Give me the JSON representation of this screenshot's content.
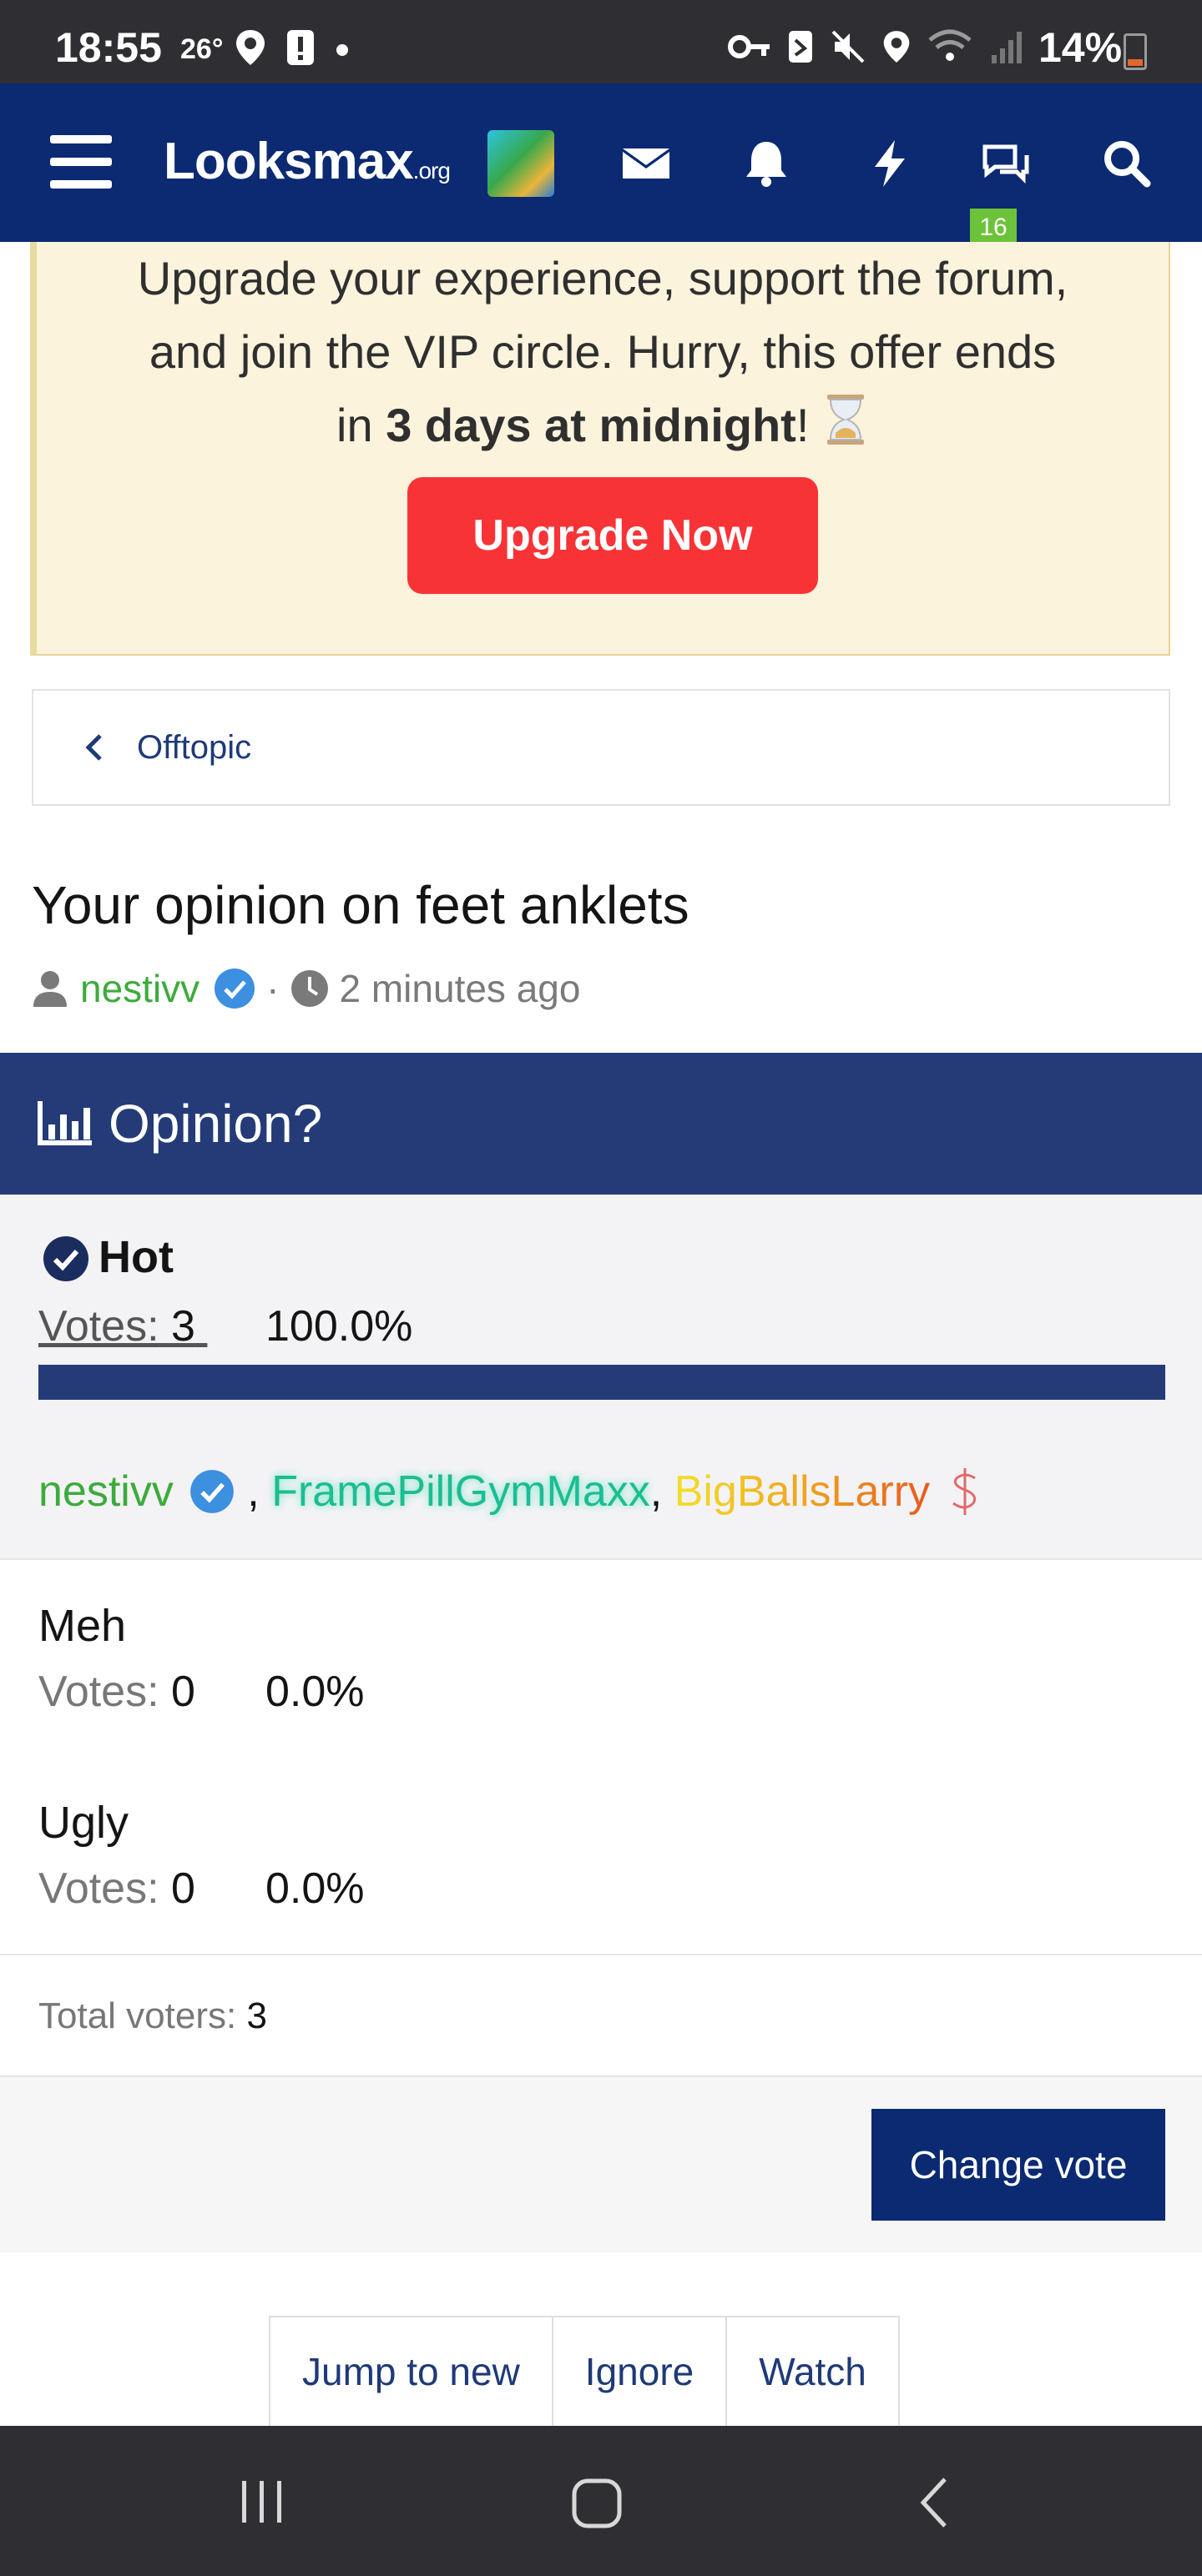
{
  "status_bar": {
    "time": "18:55",
    "temp": "26°",
    "battery": "14%"
  },
  "nav": {
    "logo_main": "Looksmax",
    "logo_suffix": ".org",
    "badge_count": "16",
    "icons": [
      "menu-icon",
      "mail-icon",
      "bell-icon",
      "bolt-icon",
      "chat-icon",
      "search-icon"
    ]
  },
  "promo": {
    "line1": "Upgrade your experience, support the forum,",
    "line2": "and join the VIP circle. Hurry, this offer ends",
    "line3_pre": "in ",
    "line3_bold": "3 days at midnight",
    "line3_post": "! ",
    "button": "Upgrade Now"
  },
  "breadcrumb": {
    "label": "Offtopic"
  },
  "thread": {
    "title": "Your opinion on feet anklets",
    "author": "nestivv",
    "separator": "·",
    "time": "2 minutes ago"
  },
  "poll": {
    "title": "Opinion?",
    "options": [
      {
        "label": "Hot",
        "votes_label": "Votes:",
        "votes": "3",
        "percent": "100.0%",
        "fraction": 1.0,
        "voted": true
      },
      {
        "label": "Meh",
        "votes_label": "Votes:",
        "votes": "0",
        "percent": "0.0%",
        "fraction": 0.0,
        "voted": false
      },
      {
        "label": "Ugly",
        "votes_label": "Votes:",
        "votes": "0",
        "percent": "0.0%",
        "fraction": 0.0,
        "voted": false
      }
    ],
    "voters": {
      "v1": "nestivv",
      "sep1": " , ",
      "v2": "FramePillGymMaxx",
      "sep2": ", ",
      "v3": "BigBallsLarry"
    },
    "total_label": "Total voters:",
    "total": "3",
    "change_vote": "Change vote"
  },
  "thread_actions": {
    "jump": "Jump to new",
    "ignore": "Ignore",
    "watch": "Watch"
  },
  "colors": {
    "nav_bg": "#0b2a72",
    "poll_head": "#243b78",
    "author_green": "#3cab3c",
    "upgrade_red": "#f83336",
    "promo_bg": "#fbf3dc"
  }
}
